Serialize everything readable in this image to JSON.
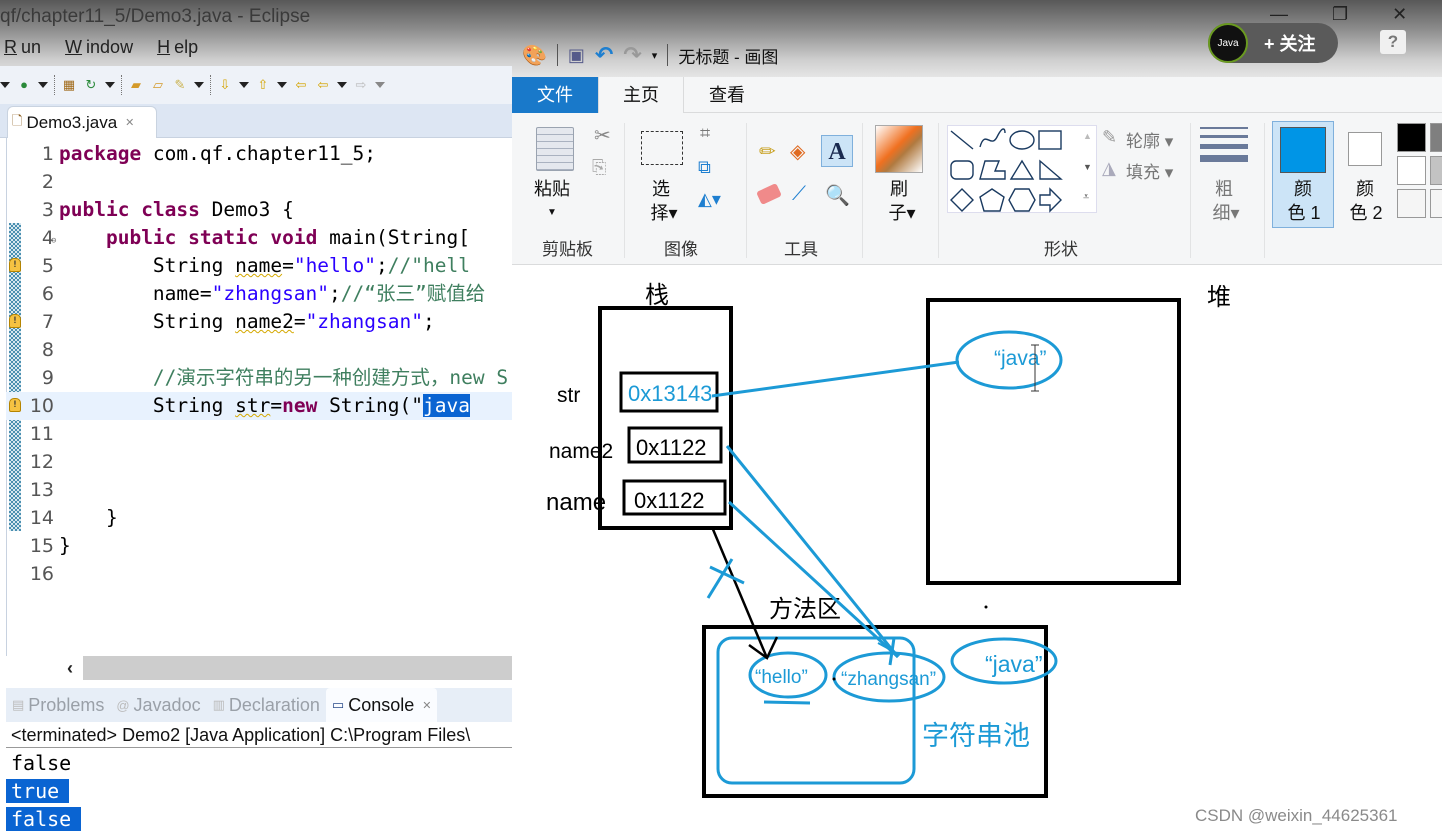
{
  "eclipse": {
    "window_title": "qf/chapter11_5/Demo3.java - Eclipse",
    "menu": [
      {
        "label": "Run",
        "mnemonic": "R"
      },
      {
        "label": "Window",
        "mnemonic": "W"
      },
      {
        "label": "Help",
        "mnemonic": "H"
      }
    ],
    "toolbar_icons": [
      "run-coverage-icon",
      "new-package-icon",
      "refresh-icon",
      "open-type-icon",
      "open-folder-icon",
      "search-icon",
      "next-annotation-icon",
      "prev-annotation-icon",
      "last-edit-icon",
      "back-icon",
      "forward-icon"
    ],
    "editor_tab": {
      "label": "Demo3.java",
      "close": "✕"
    },
    "code_lines": [
      {
        "n": "1",
        "tokens": [
          [
            "kw",
            "package"
          ],
          [
            "",
            " com.qf.chapter11_5;"
          ]
        ]
      },
      {
        "n": "2",
        "tokens": []
      },
      {
        "n": "3",
        "tokens": [
          [
            "kw",
            "public"
          ],
          [
            "",
            " "
          ],
          [
            "kw",
            "class"
          ],
          [
            "",
            " Demo3 {"
          ]
        ]
      },
      {
        "n": "4",
        "fold": true,
        "tokens": [
          [
            "",
            "    "
          ],
          [
            "kw",
            "public"
          ],
          [
            "",
            " "
          ],
          [
            "kw",
            "static"
          ],
          [
            "",
            " "
          ],
          [
            "kw",
            "void"
          ],
          [
            "",
            " main(String["
          ]
        ]
      },
      {
        "n": "5",
        "warn": true,
        "tokens": [
          [
            "",
            "        String "
          ],
          [
            "warn-u",
            "name"
          ],
          [
            "",
            "="
          ],
          [
            "str",
            "\"hello\""
          ],
          [
            "",
            ";"
          ],
          [
            "cm",
            "//\"hell"
          ]
        ]
      },
      {
        "n": "6",
        "tokens": [
          [
            "",
            "        name="
          ],
          [
            "str",
            "\"zhangsan\""
          ],
          [
            "",
            ";"
          ],
          [
            "cm",
            "//“张三”赋值给"
          ]
        ]
      },
      {
        "n": "7",
        "warn": true,
        "tokens": [
          [
            "",
            "        String "
          ],
          [
            "warn-u",
            "name2"
          ],
          [
            "",
            "="
          ],
          [
            "str",
            "\"zhangsan\""
          ],
          [
            "",
            ";"
          ]
        ]
      },
      {
        "n": "8",
        "tokens": []
      },
      {
        "n": "9",
        "tokens": [
          [
            "",
            "        "
          ],
          [
            "cm",
            "//演示字符串的另一种创建方式，new S"
          ]
        ]
      },
      {
        "n": "10",
        "warn": true,
        "current": true,
        "tokens": [
          [
            "",
            "        String "
          ],
          [
            "warn-u",
            "str"
          ],
          [
            "",
            "="
          ],
          [
            "kw",
            "new"
          ],
          [
            "",
            " String(\""
          ],
          [
            "sel",
            "java"
          ]
        ]
      },
      {
        "n": "11",
        "tokens": []
      },
      {
        "n": "12",
        "tokens": []
      },
      {
        "n": "13",
        "tokens": []
      },
      {
        "n": "14",
        "tokens": [
          [
            "",
            "    }"
          ]
        ]
      },
      {
        "n": "15",
        "tokens": [
          [
            "",
            "}"
          ]
        ]
      },
      {
        "n": "16",
        "tokens": []
      }
    ],
    "views_tabs": [
      {
        "label": "Problems",
        "icon": "problems-icon",
        "active": false
      },
      {
        "label": "Javadoc",
        "icon": "javadoc-icon",
        "active": false
      },
      {
        "label": "Declaration",
        "icon": "declaration-icon",
        "active": false
      },
      {
        "label": "Console",
        "icon": "console-icon",
        "active": true
      }
    ],
    "console_header": "<terminated> Demo2 [Java Application] C:\\Program Files\\",
    "console_output": [
      {
        "text": "false",
        "selected": false
      },
      {
        "text": "true",
        "selected": true
      },
      {
        "text": "false",
        "selected": true
      }
    ]
  },
  "paint": {
    "title": "无标题 - 画图",
    "tabs": [
      {
        "label": "文件",
        "type": "file"
      },
      {
        "label": "主页",
        "type": "active"
      },
      {
        "label": "查看",
        "type": "normal"
      }
    ],
    "groups": {
      "clipboard": {
        "label": "剪贴板",
        "paste": "粘贴"
      },
      "image": {
        "label": "图像",
        "select": [
          "选",
          "择"
        ]
      },
      "tools": {
        "label": "工具"
      },
      "brushes": {
        "label": [
          "刷",
          "子"
        ]
      },
      "shapes": {
        "label": "形状",
        "outline": "轮廓",
        "fill": "填充"
      },
      "size": {
        "label": [
          "粗",
          "细"
        ]
      },
      "color1": {
        "label": [
          "颜",
          "色 1"
        ],
        "color": "#0095e6"
      },
      "color2": {
        "label": [
          "颜",
          "色 2"
        ],
        "color": "#ffffff"
      }
    },
    "palette": [
      "#000000",
      "#7f7f7f",
      "#ffffff",
      "#c3c3c3",
      "#f5f5f5",
      "#f5f5f5"
    ],
    "accent": "#1c9ad6"
  },
  "diagram": {
    "stack_label": "栈",
    "heap_label": "堆",
    "method_area_label": "方法区",
    "string_pool_label": "字符串池",
    "stack_vars": [
      {
        "name": "str",
        "address": "0x13143",
        "address_color": "#1c9ad6"
      },
      {
        "name": "name2",
        "address": "0x1122",
        "address_color": "#000000"
      },
      {
        "name": "name",
        "address": "0x1122",
        "address_color": "#000000"
      }
    ],
    "heap_objects": [
      "“java”"
    ],
    "pool_strings": [
      "“hello”",
      "“zhangsan”",
      "“java”"
    ]
  },
  "overlay": {
    "follow_avatar": "Java",
    "follow_label": "+ 关注",
    "help": "?",
    "watermark": "CSDN @weixin_44625361"
  }
}
